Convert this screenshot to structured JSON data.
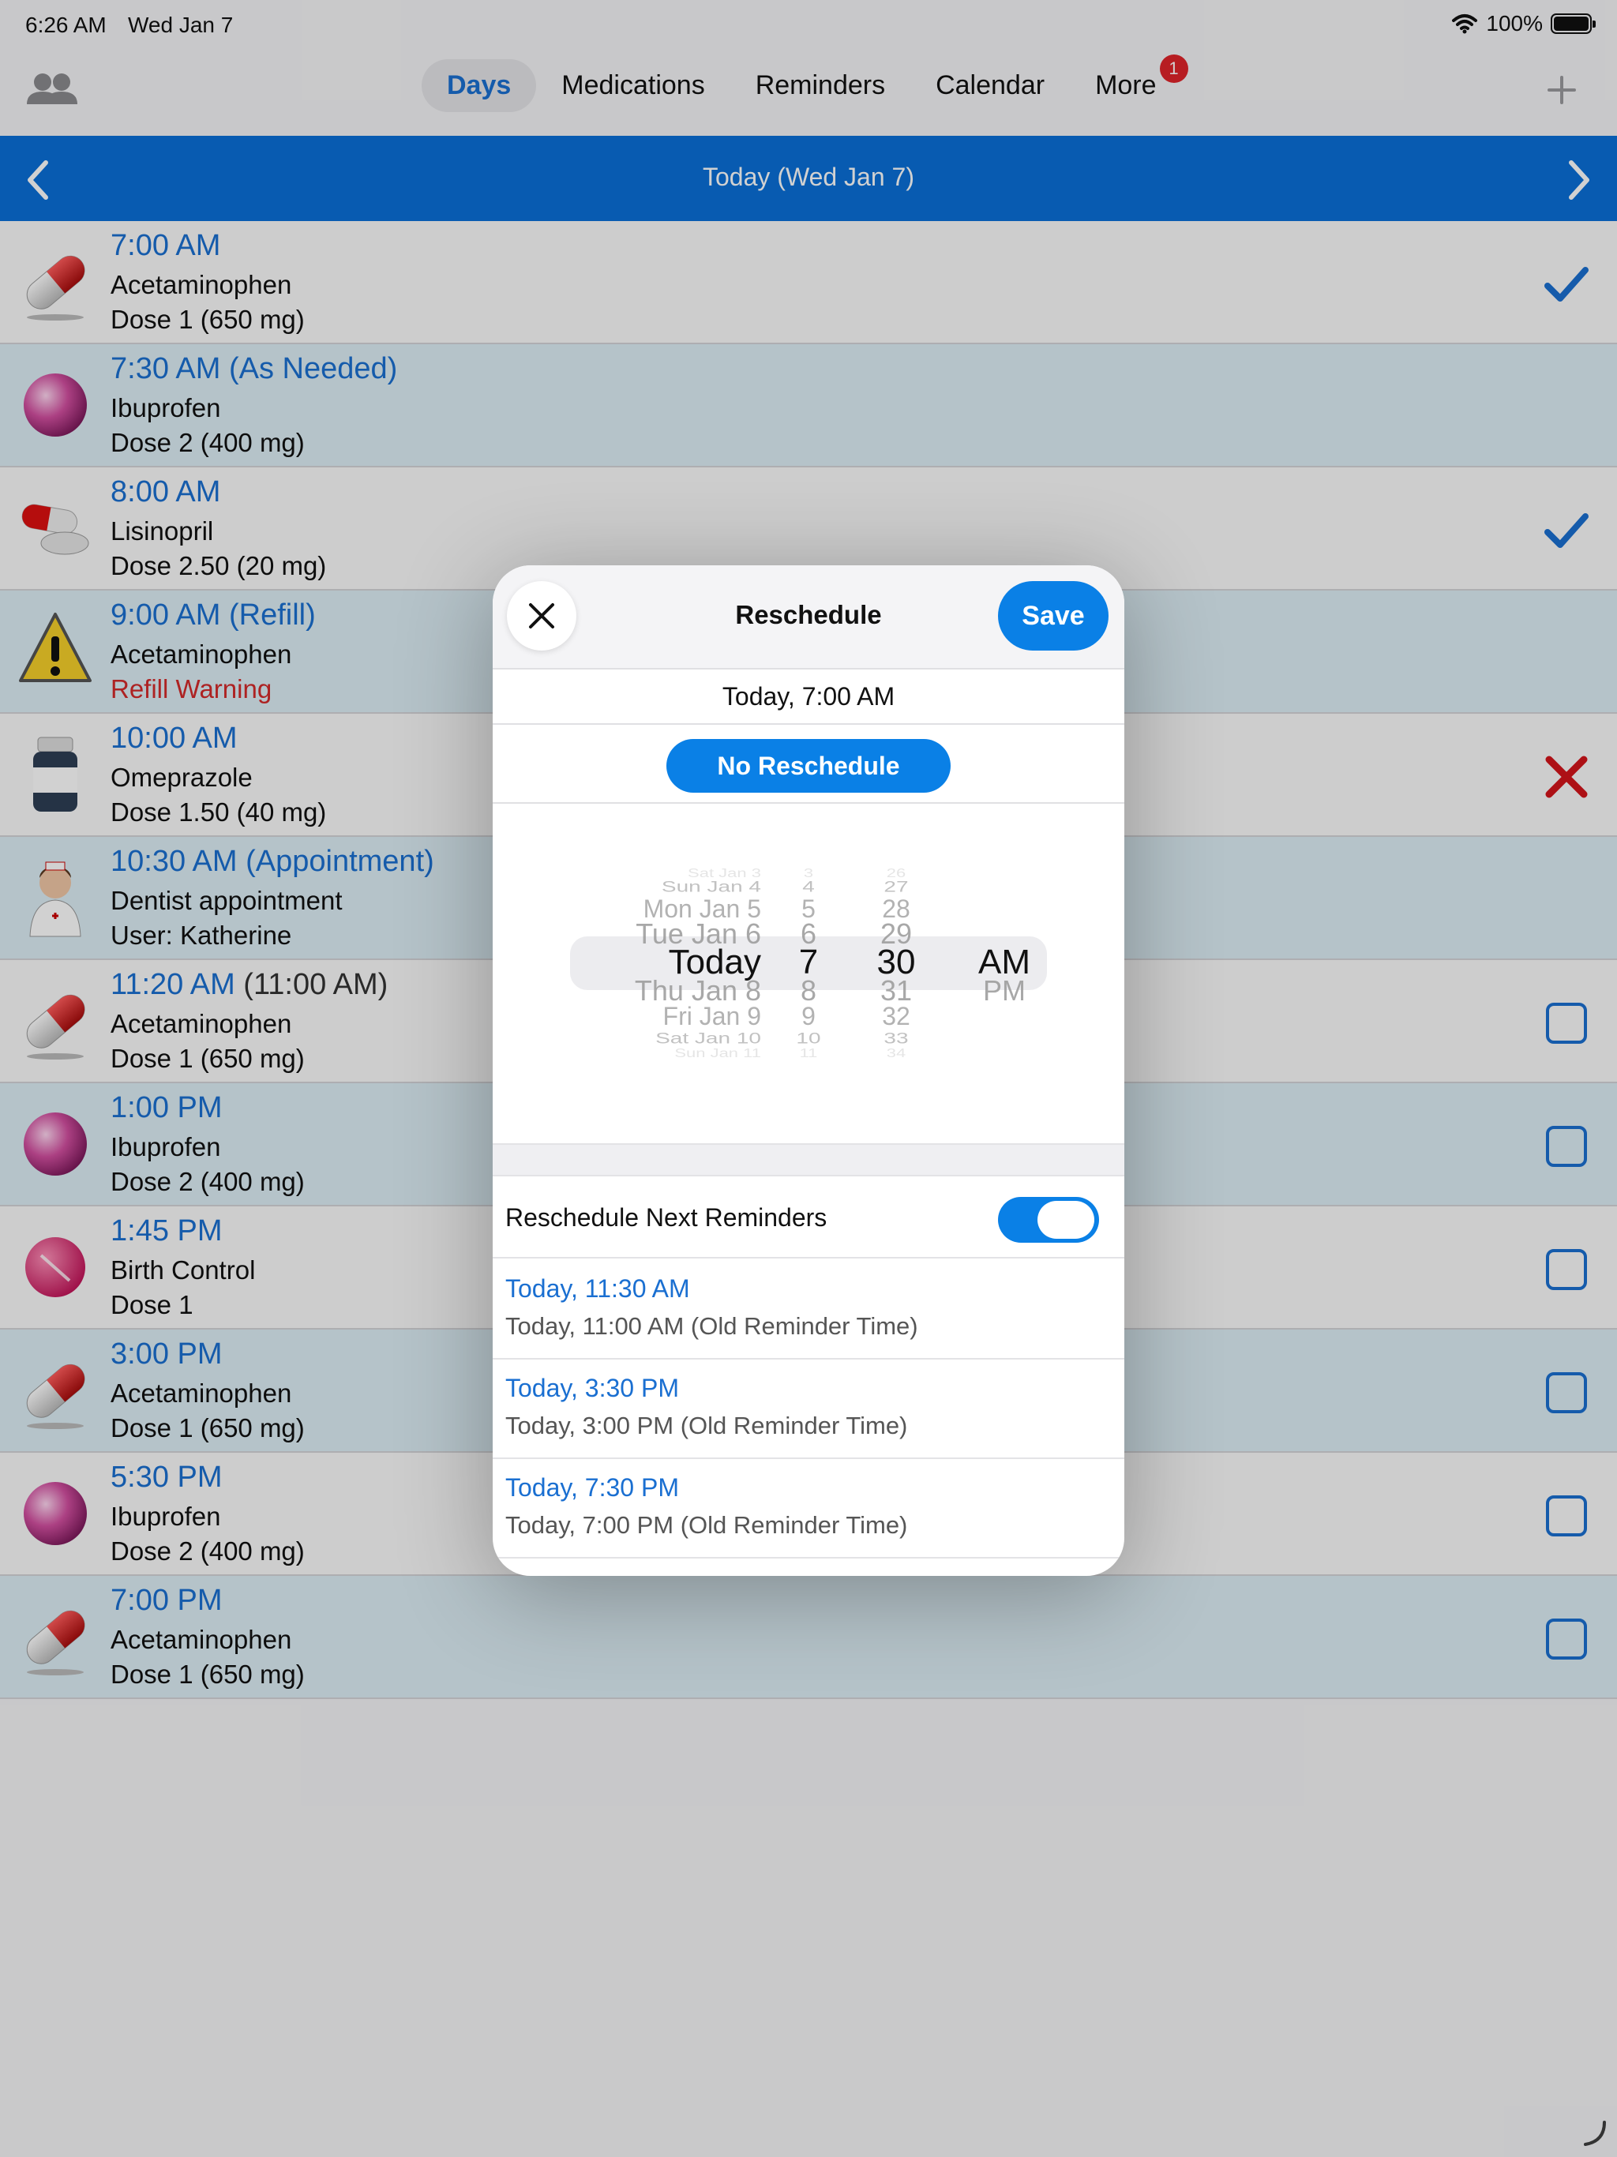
{
  "status_bar": {
    "time": "6:26 AM",
    "date": "Wed Jan 7",
    "battery": "100%"
  },
  "nav": {
    "tabs": [
      {
        "label": "Days",
        "active": true
      },
      {
        "label": "Medications"
      },
      {
        "label": "Reminders"
      },
      {
        "label": "Calendar"
      },
      {
        "label": "More",
        "badge": "1"
      }
    ]
  },
  "day_header": {
    "title": "Today (Wed Jan 7)"
  },
  "rows": [
    {
      "time": "7:00 AM",
      "line1": "Acetaminophen",
      "line2": "Dose 1 (650 mg)",
      "icon": "capsule-red-icon",
      "status": "taken"
    },
    {
      "time": "7:30 AM (As Needed)",
      "line1": "Ibuprofen",
      "line2": "Dose 2 (400 mg)",
      "icon": "pill-pink-round-icon"
    },
    {
      "time": "8:00 AM",
      "line1": "Lisinopril",
      "line2": "Dose 2.50 (20 mg)",
      "icon": "capsule-white-icon",
      "status": "taken"
    },
    {
      "time": "9:00 AM (Refill)",
      "line1": "Acetaminophen",
      "line2": "Refill Warning",
      "icon": "warning-icon"
    },
    {
      "time": "10:00 AM",
      "line1": "Omeprazole",
      "line2": "Dose 1.50 (40 mg)",
      "icon": "pill-bottle-icon",
      "status": "skipped"
    },
    {
      "time": "10:30 AM (Appointment)",
      "line1": "Dentist appointment",
      "line2": "User: Katherine",
      "icon": "nurse-icon"
    },
    {
      "time": "11:20 AM",
      "time_extra": "(11:00 AM)",
      "line1": "Acetaminophen",
      "line2": "Dose 1 (650 mg)",
      "icon": "capsule-red-icon",
      "status": "pending"
    },
    {
      "time": "1:00 PM",
      "line1": "Ibuprofen",
      "line2": "Dose 2 (400 mg)",
      "icon": "pill-pink-round-icon",
      "status": "pending"
    },
    {
      "time": "1:45 PM",
      "line1": "Birth Control",
      "line2": "Dose 1",
      "icon": "pill-pink-tablet-icon",
      "status": "pending"
    },
    {
      "time": "3:00 PM",
      "line1": "Acetaminophen",
      "line2": "Dose 1 (650 mg)",
      "icon": "capsule-red-icon",
      "status": "pending"
    },
    {
      "time": "5:30 PM",
      "line1": "Ibuprofen",
      "line2": "Dose 2 (400 mg)",
      "icon": "pill-pink-round-icon",
      "status": "pending"
    },
    {
      "time": "7:00 PM",
      "line1": "Acetaminophen",
      "line2": "Dose 1 (650 mg)",
      "icon": "capsule-red-icon",
      "status": "pending"
    }
  ],
  "modal": {
    "title": "Reschedule",
    "save_label": "Save",
    "current_time": "Today, 7:00 AM",
    "no_reschedule_label": "No Reschedule",
    "picker": {
      "dates": [
        "Sat Jan 3",
        "Sun Jan 4",
        "Mon Jan 5",
        "Tue Jan 6",
        "Today",
        "Thu Jan 8",
        "Fri Jan 9",
        "Sat Jan 10",
        "Sun Jan 11"
      ],
      "hours": [
        "3",
        "4",
        "5",
        "6",
        "7",
        "8",
        "9",
        "10",
        "11"
      ],
      "minutes": [
        "26",
        "27",
        "28",
        "29",
        "30",
        "31",
        "32",
        "33",
        "34"
      ],
      "ampm": [
        "AM",
        "PM"
      ],
      "selected_index": 4
    },
    "toggle_label": "Reschedule Next Reminders",
    "toggle_on": true,
    "reminders": [
      {
        "new": "Today, 11:30 AM",
        "old": "Today, 11:00 AM (Old Reminder Time)"
      },
      {
        "new": "Today, 3:30 PM",
        "old": "Today, 3:00 PM (Old Reminder Time)"
      },
      {
        "new": "Today, 7:30 PM",
        "old": "Today, 7:00 PM (Old Reminder Time)"
      }
    ]
  }
}
